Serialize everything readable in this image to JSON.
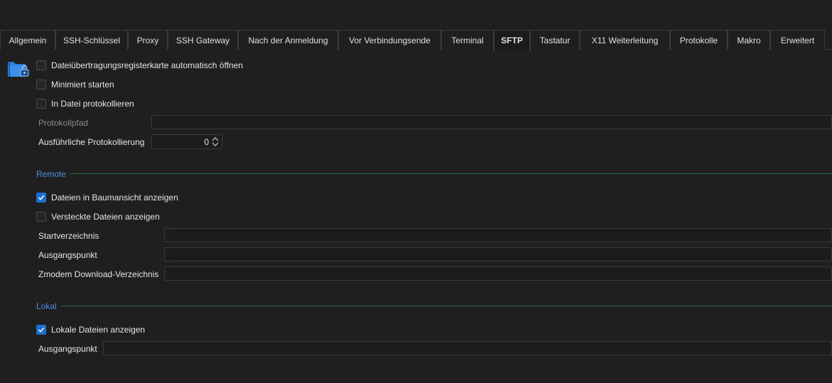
{
  "tabs": [
    {
      "label": "Allgemein",
      "active": false
    },
    {
      "label": "SSH-Schlüssel",
      "active": false
    },
    {
      "label": "Proxy",
      "active": false
    },
    {
      "label": "SSH Gateway",
      "active": false
    },
    {
      "label": "Nach der Anmeldung",
      "active": false
    },
    {
      "label": "Vor Verbindungsende",
      "active": false
    },
    {
      "label": "Terminal",
      "active": false
    },
    {
      "label": "SFTP",
      "active": true
    },
    {
      "label": "Tastatur",
      "active": false
    },
    {
      "label": "X11 Weiterleitung",
      "active": false
    },
    {
      "label": "Protokolle",
      "active": false
    },
    {
      "label": "Makro",
      "active": false
    },
    {
      "label": "Erweitert",
      "active": false
    }
  ],
  "general": {
    "auto_open_label": "Dateiübertragungsregisterkarte automatisch öffnen",
    "auto_open_checked": false,
    "minimized_label": "Minimiert starten",
    "minimized_checked": false,
    "log_to_file_label": "In Datei protokollieren",
    "log_to_file_checked": false,
    "log_path_label": "Protokollpfad",
    "log_path_value": "",
    "verbose_label": "Ausführliche Protokollierung",
    "verbose_value": "0"
  },
  "remote": {
    "title": "Remote",
    "tree_view_label": "Dateien in Baumansicht anzeigen",
    "tree_view_checked": true,
    "hidden_files_label": "Versteckte Dateien anzeigen",
    "hidden_files_checked": false,
    "start_dir_label": "Startverzeichnis",
    "start_dir_value": "",
    "origin_label": "Ausgangspunkt",
    "origin_value": "",
    "zmodem_label": "Zmodem Download-Verzeichnis",
    "zmodem_value": ""
  },
  "local": {
    "title": "Lokal",
    "show_local_label": "Lokale Dateien anzeigen",
    "show_local_checked": true,
    "origin_label": "Ausgangspunkt",
    "origin_value": ""
  },
  "colors": {
    "accent": "#1d6fd1",
    "section_title": "#4a8fe0",
    "section_line": "#1f6b55",
    "background": "#1f1f1f"
  }
}
